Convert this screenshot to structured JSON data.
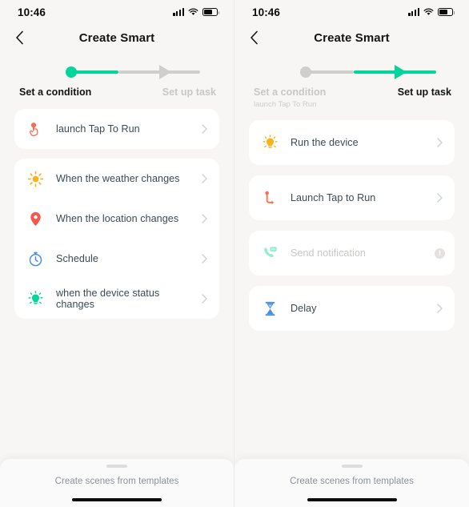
{
  "colors": {
    "accent_green": "#00d59a",
    "inactive_gray": "#cfcecc",
    "background": "#f7f6f5",
    "card": "#ffffff",
    "text_primary": "#3b4a55",
    "text_disabled": "#c9c8c6",
    "icon_orange": "#f96e51",
    "icon_amber": "#fbb118",
    "icon_red": "#f8564a",
    "icon_blue": "#4a90e2",
    "icon_green": "#00d59a"
  },
  "status_bar": {
    "time": "10:46",
    "signal_icon": "cellular-signal-icon",
    "wifi_icon": "wifi-icon",
    "battery_icon": "battery-icon"
  },
  "nav": {
    "back_icon": "chevron-left-icon",
    "title": "Create Smart"
  },
  "left_screen": {
    "stepper": {
      "step1_label": "Set a condition",
      "step1_state": "active",
      "step2_label": "Set up task",
      "step2_state": "inactive",
      "step2_subtitle": ""
    },
    "cards": [
      {
        "rows": [
          {
            "label": "launch Tap To Run",
            "icon": "tap-to-run-hand-icon",
            "disabled": false,
            "accessory": "chevron-right-icon"
          }
        ]
      },
      {
        "rows": [
          {
            "label": "When the weather changes",
            "icon": "sun-weather-icon",
            "disabled": false,
            "accessory": "chevron-right-icon"
          },
          {
            "label": "When the location changes",
            "icon": "location-pin-icon",
            "disabled": false,
            "accessory": "chevron-right-icon"
          },
          {
            "label": "Schedule",
            "icon": "stopwatch-icon",
            "disabled": false,
            "accessory": "chevron-right-icon"
          },
          {
            "label": "when the device status changes",
            "icon": "device-bulb-icon",
            "disabled": false,
            "accessory": "chevron-right-icon"
          }
        ]
      }
    ],
    "sheet": {
      "handle": "drag-handle",
      "text": "Create scenes from templates"
    }
  },
  "right_screen": {
    "stepper": {
      "step1_label": "Set a condition",
      "step1_state": "inactive",
      "step1_subtitle": "launch Tap To Run",
      "step2_label": "Set up task",
      "step2_state": "active"
    },
    "cards": [
      {
        "rows": [
          {
            "label": "Run the device",
            "icon": "bulb-amber-icon",
            "disabled": false,
            "accessory": "chevron-right-icon"
          }
        ]
      },
      {
        "rows": [
          {
            "label": "Launch Tap to Run",
            "icon": "tap-to-run-flow-icon",
            "disabled": false,
            "accessory": "chevron-right-icon"
          }
        ]
      },
      {
        "rows": [
          {
            "label": "Send notification",
            "icon": "phone-message-icon",
            "disabled": true,
            "accessory": "info-icon"
          }
        ]
      },
      {
        "rows": [
          {
            "label": "Delay",
            "icon": "hourglass-icon",
            "disabled": false,
            "accessory": "chevron-right-icon"
          }
        ]
      }
    ],
    "sheet": {
      "handle": "drag-handle",
      "text": "Create scenes from templates"
    }
  }
}
